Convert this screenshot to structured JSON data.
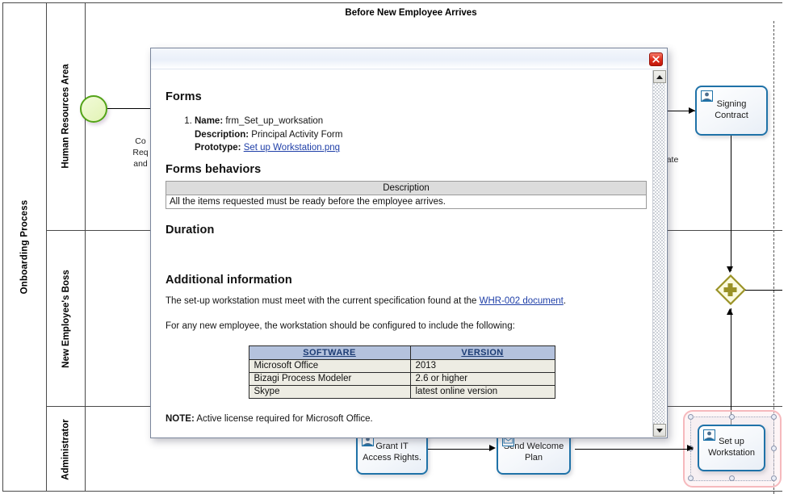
{
  "diagram": {
    "title": "Before New Employee Arrives",
    "pool_label": "Onboarding Process",
    "lanes": [
      {
        "label": "Human Resources Area"
      },
      {
        "label": "New Employee's Boss"
      },
      {
        "label": "Administrator"
      }
    ],
    "occluded_text_left": "Co\nReq\nand",
    "occluded_text_right": "ate",
    "elements": {
      "start_event_name": "start-event",
      "gateway_name": "parallel-gateway",
      "tasks": [
        {
          "label": "Signing Contract",
          "icon": "user-task-icon"
        },
        {
          "label": "Set up Workstation",
          "icon": "user-task-icon"
        },
        {
          "label": "Grant IT Access Rights.",
          "icon": "user-task-icon"
        },
        {
          "label": "Send Welcome Plan",
          "icon": "send-task-icon"
        }
      ]
    },
    "colors": {
      "task_border": "#1f72a8",
      "start_event": "#53a318",
      "gateway": "#9a9226",
      "selection": "#f6b9bd"
    }
  },
  "dialog": {
    "close_label": "Close",
    "scroll_up_label": "Scroll up",
    "scroll_down_label": "Scroll down",
    "sections": {
      "forms_heading": "Forms",
      "forms_behaviors_heading": "Forms behaviors",
      "duration_heading": "Duration",
      "additional_heading": "Additional information"
    },
    "form_item": {
      "index": "1.",
      "name_label": "Name:",
      "name_value": "frm_Set_up_worksation",
      "description_label": "Description:",
      "description_value": "Principal Activity Form",
      "prototype_label": "Prototype:",
      "prototype_link": "Set up Workstation.png"
    },
    "behaviors_table": {
      "header": "Description",
      "rows": [
        "All the items requested must be ready before the employee arrives."
      ]
    },
    "additional": {
      "paragraph1_before": "The set-up workstation must meet with the current specification found at the ",
      "paragraph1_link": "WHR-002 document",
      "paragraph1_after": ".",
      "paragraph2": "For any new employee, the workstation should be configured to include the following:",
      "note_label": "NOTE:",
      "note_text": " Active license required for Microsoft Office."
    },
    "software_table": {
      "headers": [
        "SOFTWARE",
        "VERSION"
      ],
      "rows": [
        [
          "Microsoft Office",
          "2013"
        ],
        [
          "Bizagi Process Modeler",
          "2.6 or higher"
        ],
        [
          "Skype",
          "latest online version"
        ]
      ]
    }
  }
}
